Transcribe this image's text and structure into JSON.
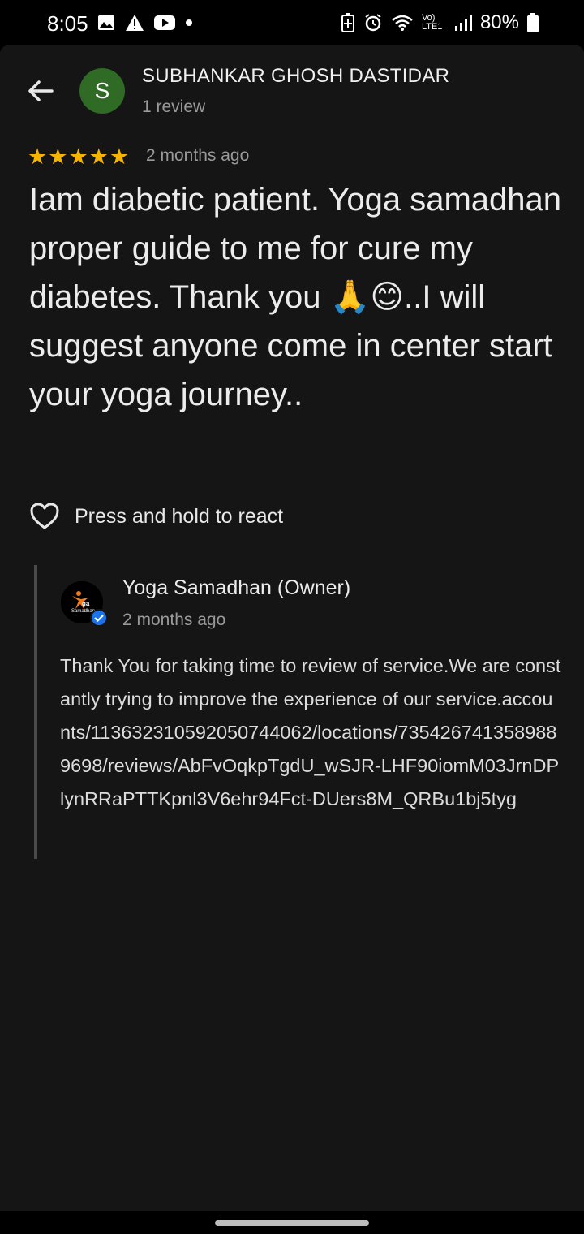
{
  "status_bar": {
    "time": "8:05",
    "battery": "80%",
    "network": "Vo) LTE1"
  },
  "reviewer": {
    "initial": "S",
    "name": "SUBHANKAR GHOSH DASTIDAR",
    "review_count": "1 review",
    "avatar_color": "#2f6b25"
  },
  "review": {
    "rating": 5,
    "stars": [
      "★",
      "★",
      "★",
      "★",
      "★"
    ],
    "date": "2 months ago",
    "text": "Iam diabetic patient. Yoga samadhan proper guide to me for cure my diabetes. Thank you 🙏😊..I will suggest anyone come in center start your yoga journey.."
  },
  "react": {
    "label": "Press and hold to react",
    "icon": "heart-outline-icon"
  },
  "owner_reply": {
    "name": "Yoga Samadhan (Owner)",
    "date": "2 months ago",
    "logo_text": "Yoga Samadhan",
    "text": "Thank You for taking time to review of service.We are constantly trying to improve the experience of our service.accounts/113632310592050744062/locations/7354267413589889698/reviews/AbFvOqkpTgdU_wSJR-LHF90iomM03JrnDPlynRRaPTTKpnl3V6ehr94Fct-DUers8M_QRBu1bj5tyg"
  },
  "colors": {
    "star": "#f4b400",
    "background": "#151515",
    "verified": "#1a73e8"
  }
}
